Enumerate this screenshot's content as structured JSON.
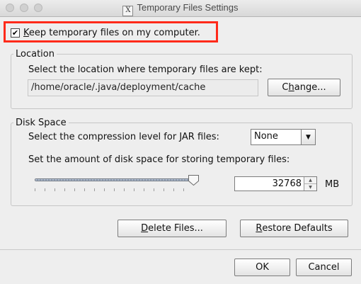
{
  "window": {
    "title": "Temporary Files Settings",
    "x11_badge": "X"
  },
  "keep_files": {
    "checked": true,
    "check_glyph": "✔",
    "label_mnemonic": "K",
    "label_rest": "eep temporary files on my computer."
  },
  "location": {
    "legend": "Location",
    "prompt": "Select the location where temporary files are kept:",
    "path": "/home/oracle/.java/deployment/cache",
    "change_button": {
      "pre": "C",
      "mnemonic": "h",
      "post": "ange..."
    }
  },
  "disk_space": {
    "legend": "Disk Space",
    "compression_label": "Select the compression level for JAR files:",
    "compression": {
      "selected": "None"
    },
    "amount_label": "Set the amount of disk space for storing temporary files:",
    "slider_level": 1.0,
    "amount_value": "32768",
    "unit": "MB"
  },
  "buttons": {
    "delete_files": {
      "mnemonic": "D",
      "rest": "elete Files..."
    },
    "restore_defaults": {
      "mnemonic": "R",
      "rest": "estore Defaults"
    },
    "ok": "OK",
    "cancel": "Cancel"
  }
}
